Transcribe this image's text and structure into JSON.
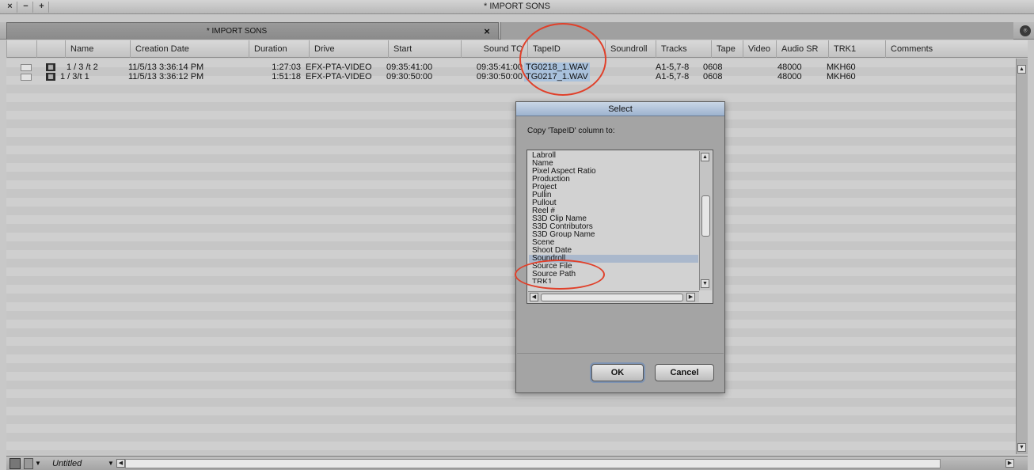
{
  "window": {
    "title": "* IMPORT SONS",
    "buttons": [
      "×",
      "−",
      "+"
    ]
  },
  "tab": {
    "label": "* IMPORT SONS",
    "close": "×",
    "menu": "⌾"
  },
  "columns": [
    "Name",
    "Creation Date",
    "Duration",
    "Drive",
    "Start",
    "Sound TC",
    "TapeID",
    "Soundroll",
    "Tracks",
    "Tape",
    "Video",
    "Audio SR",
    "TRK1",
    "Comments"
  ],
  "rows": [
    {
      "name": "1 / 3  /t 2",
      "creation_date": "11/5/13 3:36:14 PM",
      "duration": "1:27:03",
      "drive": "EFX-PTA-VIDEO",
      "start": "09:35:41:00",
      "sound_tc": "09:35:41:00",
      "tape_id": "TG0218_1.WAV",
      "soundroll": "",
      "tracks": "A1-5,7-8",
      "tape": "0608",
      "video": "",
      "audio_sr": "48000",
      "trk1": "MKH60",
      "comments": ""
    },
    {
      "name": "1 / 3/t 1",
      "creation_date": "11/5/13 3:36:12 PM",
      "duration": "1:51:18",
      "drive": "EFX-PTA-VIDEO",
      "start": "09:30:50:00",
      "sound_tc": "09:30:50:00",
      "tape_id": "TG0217_1.WAV",
      "soundroll": "",
      "tracks": "A1-5,7-8",
      "tape": "0608",
      "video": "",
      "audio_sr": "48000",
      "trk1": "MKH60",
      "comments": ""
    }
  ],
  "bottom": {
    "view_name": "Untitled"
  },
  "dialog": {
    "title": "Select",
    "prompt": "Copy 'TapeID' column to:",
    "items": [
      "Labroll",
      "Name",
      "Pixel Aspect Ratio",
      "Production",
      "Project",
      "Pullin",
      "Pullout",
      "Reel #",
      "S3D Clip Name",
      "S3D Contributors",
      "S3D Group Name",
      "Scene",
      "Shoot Date",
      "Soundroll",
      "Source File",
      "Source Path",
      "TRK1"
    ],
    "selected": "Soundroll",
    "ok_label": "OK",
    "cancel_label": "Cancel"
  },
  "colors": {
    "annotation": "#e0402a",
    "selection": "#aab8cc",
    "tape_highlight": "#a9c1dc"
  }
}
